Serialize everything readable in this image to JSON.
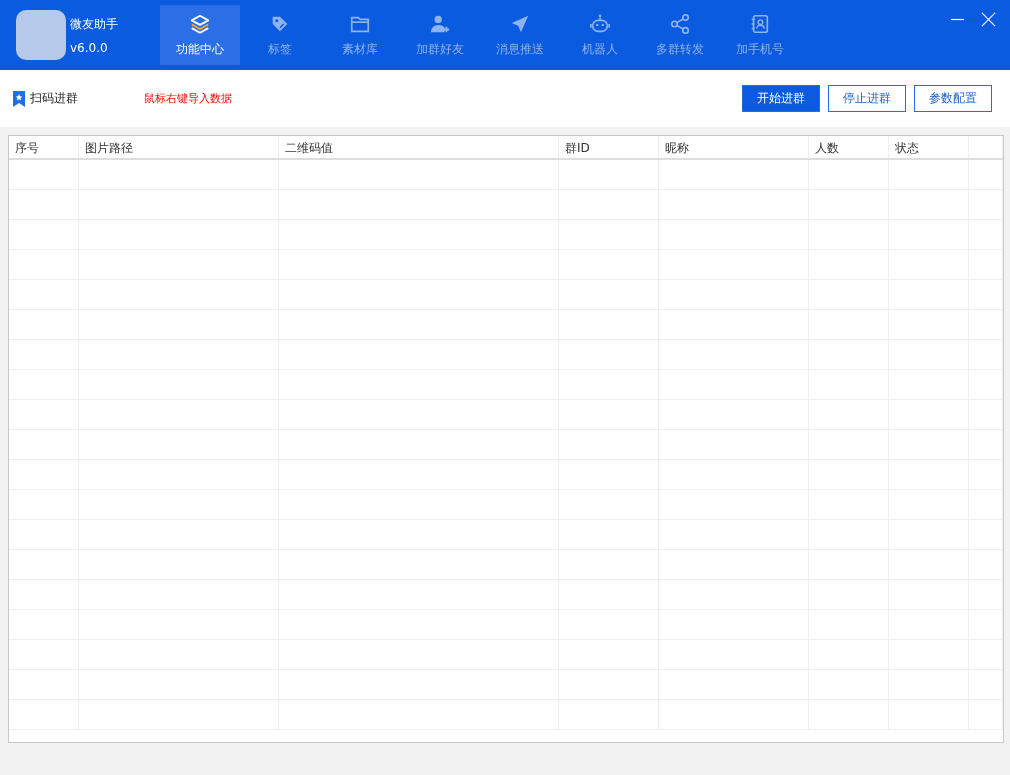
{
  "app": {
    "name": "微友助手",
    "version": "v6.0.0"
  },
  "tabs": [
    {
      "label": "功能中心",
      "kind": "layers",
      "selected": true
    },
    {
      "label": "标签",
      "kind": "tag",
      "selected": false
    },
    {
      "label": "素材库",
      "kind": "folder",
      "selected": false
    },
    {
      "label": "加群好友",
      "kind": "adduser",
      "selected": false
    },
    {
      "label": "消息推送",
      "kind": "send",
      "selected": false
    },
    {
      "label": "机器人",
      "kind": "robot",
      "selected": false
    },
    {
      "label": "多群转发",
      "kind": "share",
      "selected": false
    },
    {
      "label": "加手机号",
      "kind": "contact",
      "selected": false
    }
  ],
  "toolbar": {
    "title": "扫码进群",
    "hint": "鼠标右键导入数据",
    "buttons": [
      {
        "label": "开始进群",
        "primary": true
      },
      {
        "label": "停止进群",
        "primary": false
      },
      {
        "label": "参数配置",
        "primary": false
      }
    ]
  },
  "table": {
    "columns": [
      "序号",
      "图片路径",
      "二维码值",
      "群ID",
      "昵称",
      "人数",
      "状态"
    ]
  }
}
